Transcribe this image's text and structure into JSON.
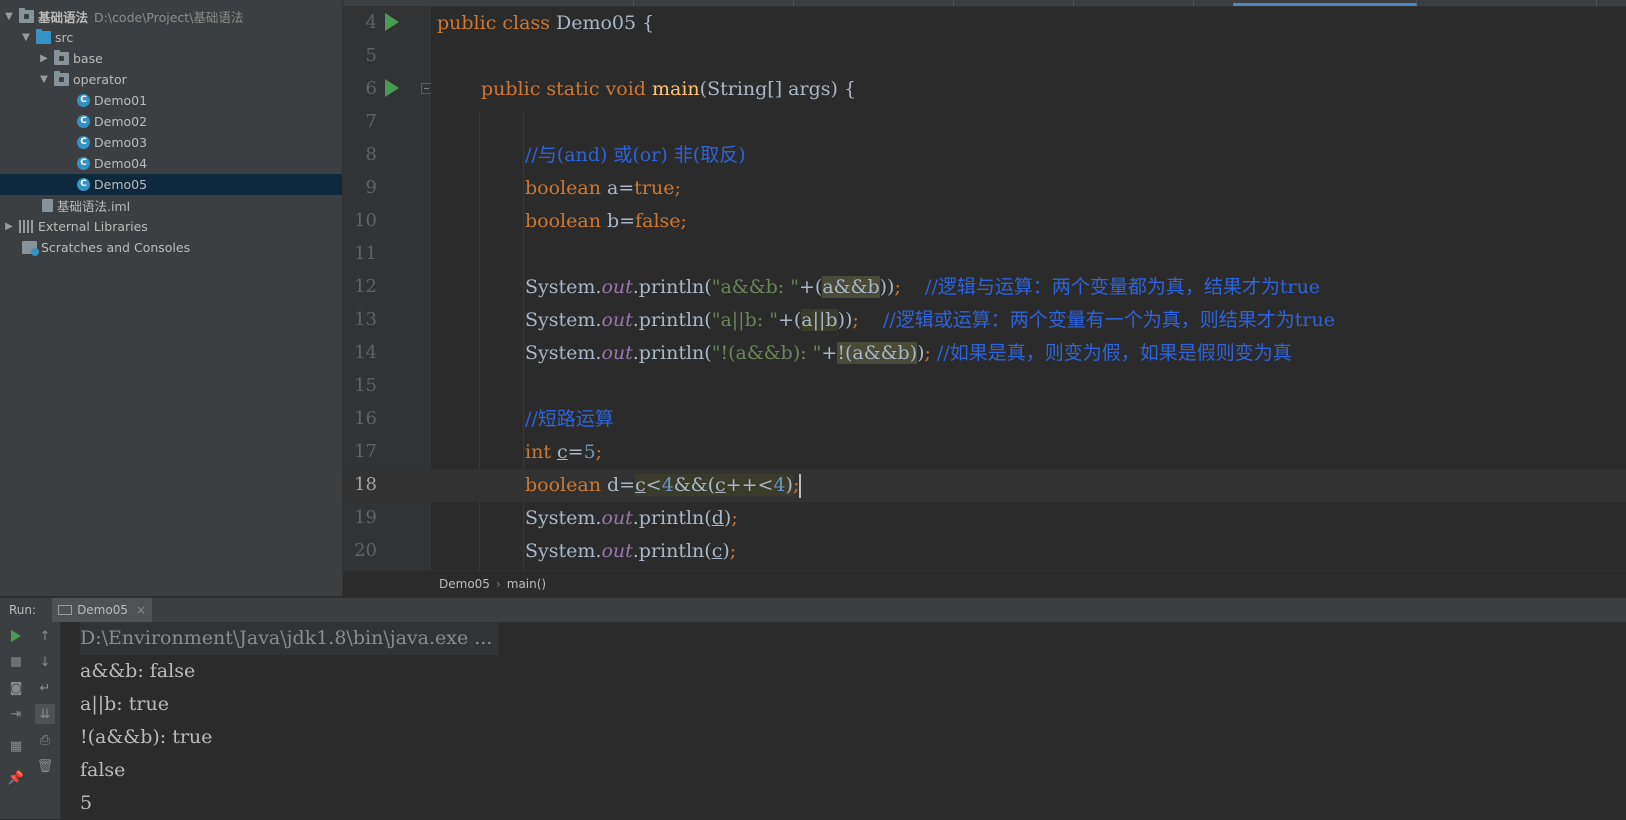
{
  "project_tree": {
    "module_name": "基础语法",
    "module_path": "D:\\code\\Project\\基础语法",
    "src": "src",
    "base": "base",
    "operator": "operator",
    "classes": [
      "Demo01",
      "Demo02",
      "Demo03",
      "Demo04",
      "Demo05"
    ],
    "selected": "Demo05",
    "iml_file": "基础语法.iml",
    "external_libraries": "External Libraries",
    "scratches": "Scratches and Consoles"
  },
  "editor": {
    "line_numbers": [
      "4",
      "5",
      "6",
      "7",
      "8",
      "9",
      "10",
      "11",
      "12",
      "13",
      "14",
      "15",
      "16",
      "17",
      "18",
      "19",
      "20"
    ],
    "current_line": "18",
    "code": {
      "l4": {
        "kw1": "public",
        "kw2": "class",
        "name": "Demo05",
        "brace": "{"
      },
      "l6": {
        "kw1": "public",
        "kw2": "static",
        "kw3": "void",
        "fn": "main",
        "params": "(String[] args)",
        "brace": "{"
      },
      "l8": {
        "comment": "//与(and) 或(or) 非(取反)"
      },
      "l9": {
        "kw": "boolean",
        "lhs": "a=",
        "val": "true",
        "semi": ";"
      },
      "l10": {
        "kw": "boolean",
        "lhs": "b=",
        "val": "false",
        "semi": ";"
      },
      "l12": {
        "sys": "System.",
        "out": "out",
        "println": ".println(",
        "str": "\"a&&b: \"",
        "plus": "+(",
        "expr": "a&&b",
        "close": "))",
        "semi": ";",
        "comment": "//逻辑与运算：两个变量都为真，结果才为true"
      },
      "l13": {
        "sys": "System.",
        "out": "out",
        "println": ".println(",
        "str": "\"a||b: \"",
        "plus": "+(",
        "expr": "a||b",
        "close": "))",
        "semi": ";",
        "comment": "//逻辑或运算：两个变量有一个为真，则结果才为true"
      },
      "l14": {
        "sys": "System.",
        "out": "out",
        "println": ".println(",
        "str": "\"!(a&&b): \"",
        "plus": "+",
        "expr": "!(a&&b)",
        "close": ")",
        "semi": ";",
        "comment": "//如果是真，则变为假，如果是假则变为真"
      },
      "l16": {
        "comment": "//短路运算"
      },
      "l17": {
        "kw": "int",
        "var": "c",
        "eq": "=",
        "num": "5",
        "semi": ";"
      },
      "l18": {
        "kw": "boolean",
        "lhs": "d=",
        "c1": "c",
        "lt1": "<",
        "n1": "4",
        "and": "&&(",
        "c2": "c",
        "inc": "++<",
        "n2": "4",
        "close": ")",
        "semi": ";"
      },
      "l19": {
        "sys": "System.",
        "out": "out",
        "println": ".println(",
        "var": "d",
        "close": ")",
        "semi": ";"
      },
      "l20": {
        "sys": "System.",
        "out": "out",
        "println": ".println(",
        "var": "c",
        "close": ")",
        "semi": ";"
      }
    },
    "breadcrumb": [
      "Demo05",
      "main()"
    ]
  },
  "run": {
    "label": "Run:",
    "tab": "Demo05",
    "output": [
      "D:\\Environment\\Java\\jdk1.8\\bin\\java.exe ...",
      "a&&b: false",
      "a||b: true",
      "!(a&&b): true",
      "false",
      "5"
    ]
  },
  "colors": {
    "keyword": "#cc7832",
    "string": "#6a8759",
    "comment": "#2e63d9",
    "run_green": "#499c54",
    "selection": "#0d293e"
  },
  "icons": [
    "run-gutter-icon",
    "fold-icon",
    "folder-icon",
    "class-icon",
    "rerun-icon",
    "stop-icon",
    "camera-icon",
    "login-icon",
    "wrap-icon",
    "scroll-to-end-icon",
    "print-icon",
    "trash-icon",
    "layout-icon",
    "pin-icon"
  ]
}
